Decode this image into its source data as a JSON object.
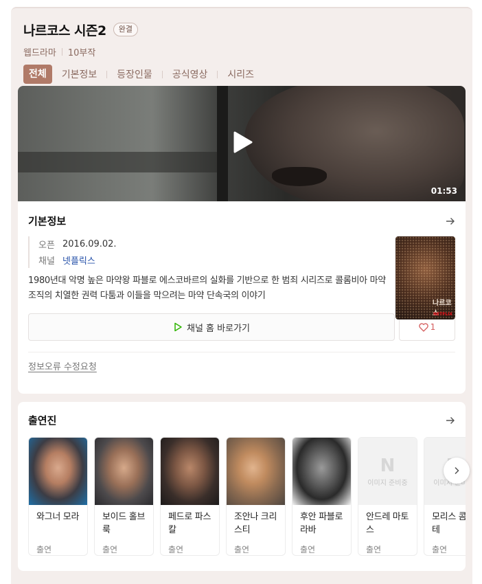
{
  "header": {
    "title": "나르코스 시즌2",
    "badge": "완결",
    "genre": "웹드라마",
    "episodes": "10부작"
  },
  "tabs": [
    {
      "label": "전체",
      "active": true
    },
    {
      "label": "기본정보",
      "active": false
    },
    {
      "label": "등장인물",
      "active": false
    },
    {
      "label": "공식영상",
      "active": false
    },
    {
      "label": "시리즈",
      "active": false
    }
  ],
  "video": {
    "duration": "01:53",
    "icon": "play-icon"
  },
  "info": {
    "section_title": "기본정보",
    "rows": [
      {
        "key": "오픈",
        "value": "2016.09.02."
      },
      {
        "key": "채널",
        "value": "넷플릭스"
      }
    ],
    "description": "1980년대 악명 높은 마약왕 파블로 에스코바르의 실화를 기반으로 한 범죄 시리즈로 콜롬비아 마약 조직의 치열한 권력 다툼과 이들을 막으려는 마약 단속국의 이야기",
    "poster": {
      "title_text": "나르코스",
      "brand": "NETFLIX"
    },
    "channel_button": "채널 홈 바로가기",
    "like_count": "1",
    "report_link": "정보오류 수정요청"
  },
  "cast": {
    "section_title": "출연진",
    "items": [
      {
        "name": "와그너 모라",
        "role": "출연",
        "has_photo": true
      },
      {
        "name": "보이드 홀브룩",
        "role": "출연",
        "has_photo": true
      },
      {
        "name": "페드로 파스칼",
        "role": "출연",
        "has_photo": true
      },
      {
        "name": "조안나 크리스티",
        "role": "출연",
        "has_photo": true
      },
      {
        "name": "후안 파블로 라바",
        "role": "출연",
        "has_photo": true
      },
      {
        "name": "안드레 마토스",
        "role": "출연",
        "has_photo": false
      },
      {
        "name": "모리스 콤프테",
        "role": "출연",
        "has_photo": false
      }
    ],
    "placeholder_text": "이미지 준비중",
    "placeholder_logo": "N"
  },
  "colors": {
    "accent": "#b07a68",
    "page_bg": "#f4eeec",
    "link": "#2450a8",
    "play_green": "#2db400",
    "heart": "#d45b5b"
  }
}
